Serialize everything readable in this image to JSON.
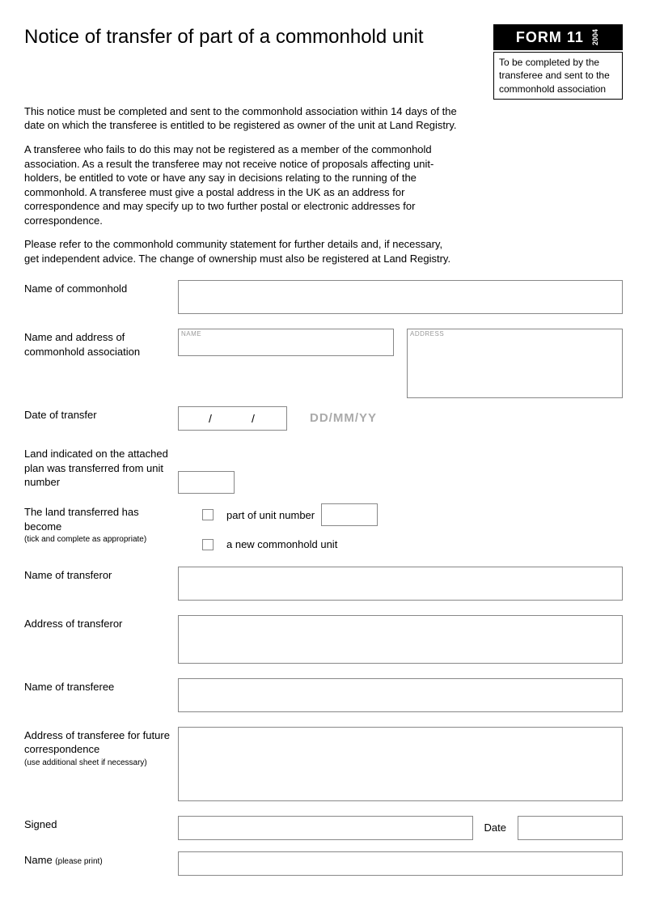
{
  "header": {
    "title": "Notice of transfer of part of a commonhold unit",
    "form_number": "FORM 11",
    "form_year": "2004",
    "note_box": "To be completed by the transferee and sent to the commonhold association"
  },
  "intro": {
    "p1": "This notice must be completed and sent to the commonhold association within 14 days of the date on which the transferee is entitled to be registered as owner of the unit at Land Registry.",
    "p2": "A transferee who fails to do this may not be registered as a member of the commonhold association. As a result the transferee may not receive notice of proposals affecting unit-holders, be entitled to vote or have any say in decisions relating to the running of the commonhold. A transferee must give a postal address in the UK as an address for correspondence and may specify up to two further postal or electronic addresses for correspondence.",
    "p3": "Please refer to the commonhold community statement for further details and, if necessary, get independent advice. The change of ownership must also be registered at Land Registry."
  },
  "fields": {
    "commonhold_name": {
      "label": "Name of commonhold"
    },
    "association": {
      "label": "Name and address of commonhold association",
      "name_hint": "NAME",
      "address_hint": "ADDRESS"
    },
    "transfer_date": {
      "label": "Date of transfer",
      "separator": "/        /",
      "hint": "DD/MM/YY"
    },
    "from_unit": {
      "label": "Land indicated on the attached plan was transferred from unit number"
    },
    "become": {
      "label": "The land transferred has become",
      "sublabel": "(tick and complete as appropriate)",
      "opt1": "part of unit number",
      "opt2": "a new commonhold unit"
    },
    "transferor_name": {
      "label": "Name of transferor"
    },
    "transferor_addr": {
      "label": "Address of transferor"
    },
    "transferee_name": {
      "label": "Name of transferee"
    },
    "transferee_addr": {
      "label": "Address of transferee for future correspondence",
      "sublabel": "(use additional sheet if necessary)"
    },
    "signed": {
      "label": "Signed",
      "date_label": "Date"
    },
    "print_name": {
      "label": "Name ",
      "sublabel": "(please print)"
    }
  }
}
